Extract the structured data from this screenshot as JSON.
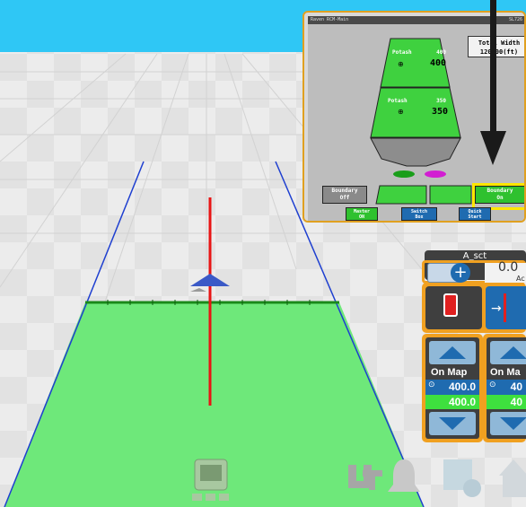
{
  "vt": {
    "title": "Raven RCM-Main",
    "title_right": "SL726",
    "total_width_label": "Total Width",
    "total_width_value": "120.00(ft)",
    "bin_upper_label": "Potash",
    "bin_upper_target": "400",
    "bin_upper_rate": "400",
    "bin_lower_label": "Potash",
    "bin_lower_target": "350",
    "bin_lower_rate": "350",
    "boundary_off_label": "Boundary\nOff",
    "boundary_on_label": "Boundary\nOn",
    "master_on_label": "Master\nON",
    "switch_box_label": "Switch\nBox",
    "quick_start_label": "Quick\nStart"
  },
  "sct": {
    "label": "A_sct",
    "value": "0.0",
    "unit": "Ac"
  },
  "product_1": {
    "mode": "On Map",
    "target_rate": "400.0",
    "actual_rate": "400.0"
  },
  "product_2": {
    "mode": "On Ma",
    "target_rate": "40",
    "actual_rate": "40"
  },
  "colors": {
    "sky": "#2fc7f5",
    "field": "#6ee87a",
    "accent_orange": "#f0a020",
    "highlight_yellow": "#ffe600",
    "guidance_red": "#e81414",
    "boundary_blue": "#1e3fd0"
  },
  "icons": [
    "vehicle-arrow-icon",
    "up-arrow-icon",
    "down-arrow-icon",
    "swath-icon",
    "guidance-line-icon",
    "ut-icon",
    "bell-icon",
    "settings-icon",
    "home-icon",
    "display-icon"
  ]
}
